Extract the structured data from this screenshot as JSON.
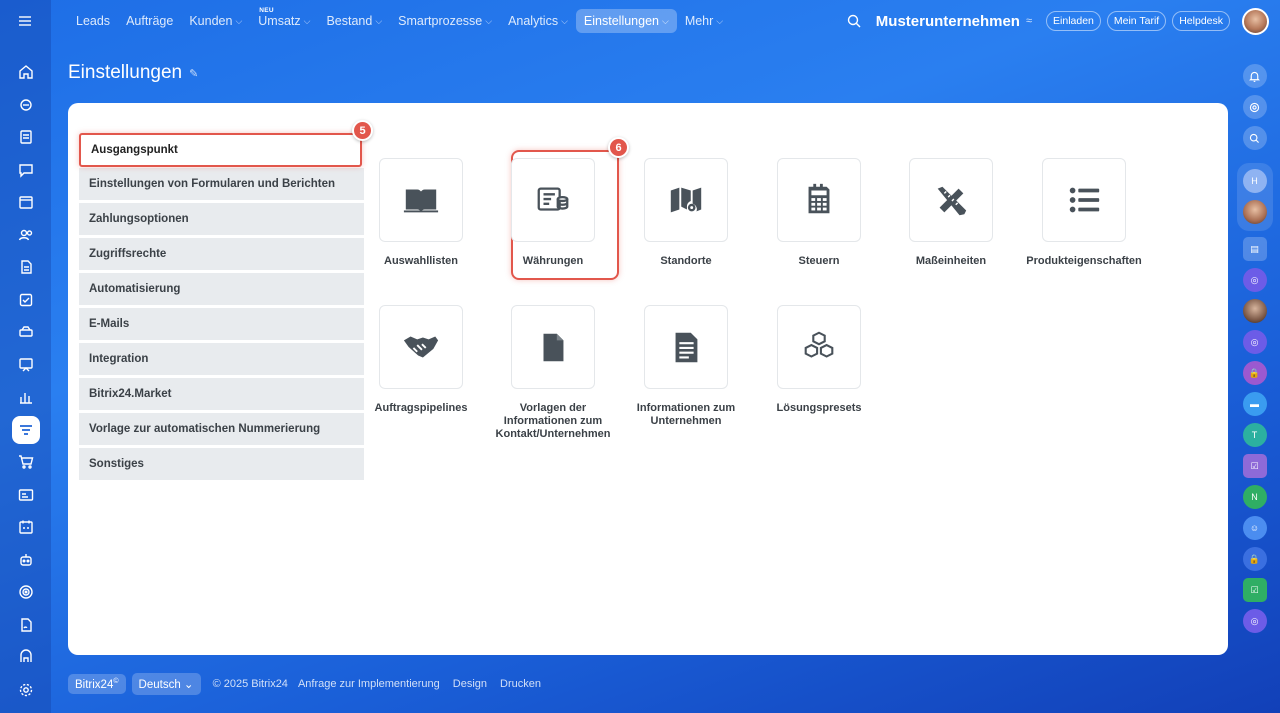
{
  "nav": {
    "items": [
      {
        "label": "Leads",
        "chev": false,
        "active": false
      },
      {
        "label": "Aufträge",
        "chev": false,
        "active": false
      },
      {
        "label": "Kunden",
        "chev": true,
        "active": false
      },
      {
        "label": "Umsatz",
        "chev": true,
        "active": false,
        "badge": "NEU"
      },
      {
        "label": "Bestand",
        "chev": true,
        "active": false
      },
      {
        "label": "Smartprozesse",
        "chev": true,
        "active": false
      },
      {
        "label": "Analytics",
        "chev": true,
        "active": false
      },
      {
        "label": "Einstellungen",
        "chev": true,
        "active": true
      },
      {
        "label": "Mehr",
        "chev": true,
        "active": false
      }
    ]
  },
  "header": {
    "company": "Musterunternehmen",
    "invite": "Einladen",
    "tariff": "Mein Tarif",
    "helpdesk": "Helpdesk"
  },
  "page": {
    "title": "Einstellungen"
  },
  "menu": {
    "items": [
      "Ausgangspunkt",
      "Einstellungen von Formularen und Berichten",
      "Zahlungsoptionen",
      "Zugriffsrechte",
      "Automatisierung",
      "E-Mails",
      "Integration",
      "Bitrix24.Market",
      "Vorlage zur automatischen Nummerierung",
      "Sonstiges"
    ],
    "active_index": 0
  },
  "steps": {
    "menu": "5",
    "tile": "6"
  },
  "tiles": [
    {
      "label": "Auswahllisten",
      "icon": "book-icon"
    },
    {
      "label": "Währungen",
      "icon": "currency-icon"
    },
    {
      "label": "Standorte",
      "icon": "map-icon"
    },
    {
      "label": "Steuern",
      "icon": "calculator-icon"
    },
    {
      "label": "Maßeinheiten",
      "icon": "ruler-pencil-icon"
    },
    {
      "label": "Produkteigenschaften",
      "icon": "list-icon"
    },
    {
      "label": "Auftragspipelines",
      "icon": "handshake-icon"
    },
    {
      "label": "Vorlagen der Informationen zum Kontakt/Unternehmen",
      "icon": "document-icon"
    },
    {
      "label": "Informationen zum Unternehmen",
      "icon": "text-document-icon"
    },
    {
      "label": "Lösungspresets",
      "icon": "cubes-icon"
    }
  ],
  "right_bar": {
    "letters": [
      "H",
      "T",
      "N"
    ]
  },
  "footer": {
    "brand": "Bitrix24",
    "language": "Deutsch",
    "copyright": "© 2025 Bitrix24",
    "links": [
      "Anfrage zur Implementierung",
      "Design",
      "Drucken"
    ]
  }
}
